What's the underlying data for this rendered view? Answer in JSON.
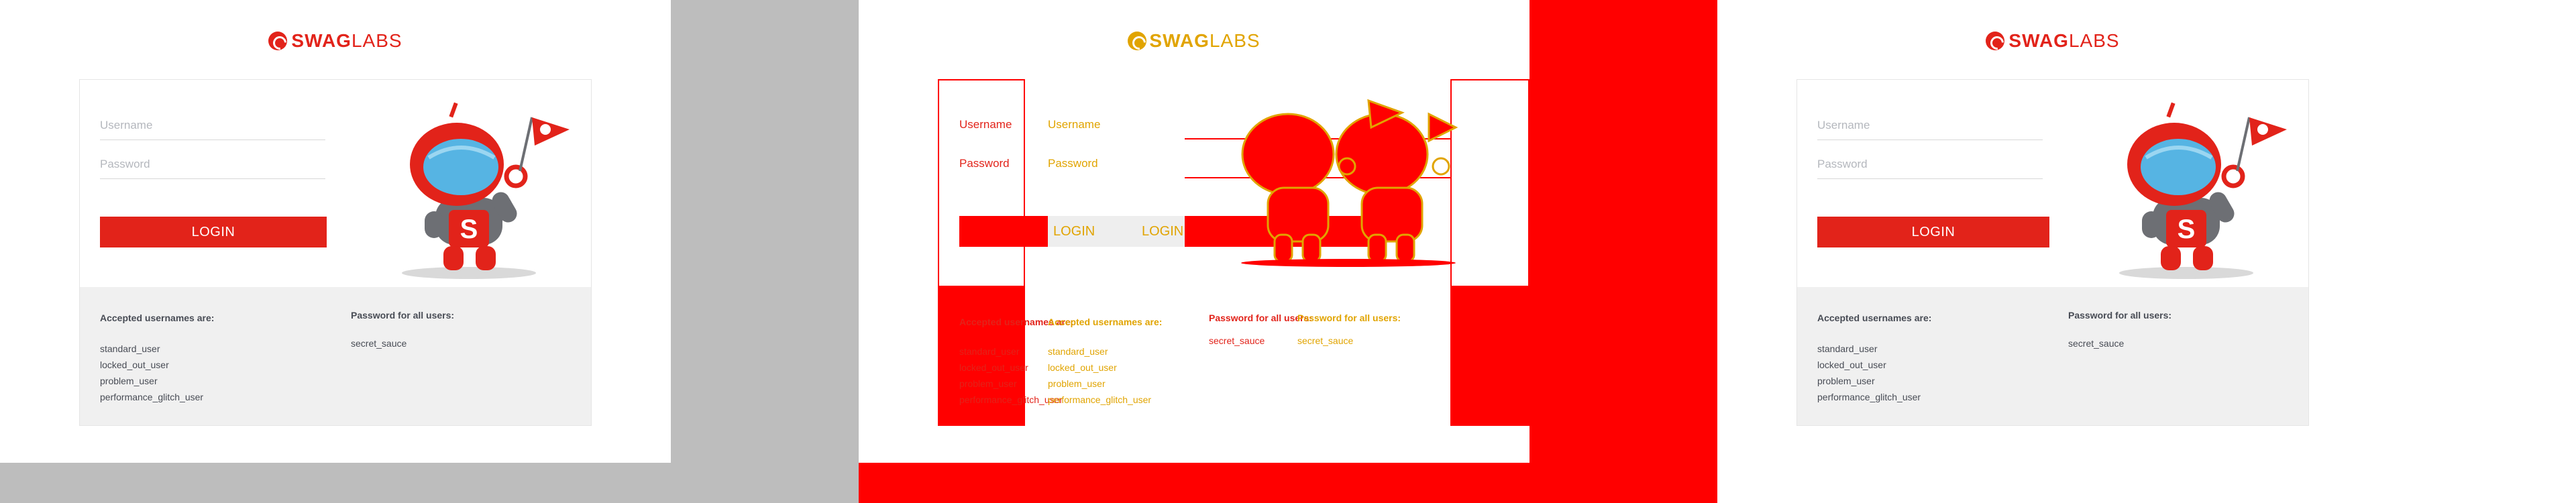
{
  "logo": {
    "bold": "SWAG",
    "light": "LABS"
  },
  "login": {
    "username_placeholder": "Username",
    "password_placeholder": "Password",
    "button_label": "LOGIN"
  },
  "credentials": {
    "usernames_heading": "Accepted usernames are:",
    "usernames": [
      "standard_user",
      "locked_out_user",
      "problem_user",
      "performance_glitch_user"
    ],
    "password_heading": "Password for all users:",
    "password": "secret_sauce"
  },
  "colors": {
    "brand_red": "#e2231a",
    "text": "#484c55",
    "placeholder": "#b4b7bd",
    "credentials_bg": "#f0f0f0",
    "diff_red": "#ff0000",
    "diff_yellow": "#e1a400",
    "backdrop_gray": "#bdbdbd"
  },
  "icons": {
    "logo": "swag-labs-logo-icon",
    "mascot": "robot-mascot-illustration"
  }
}
